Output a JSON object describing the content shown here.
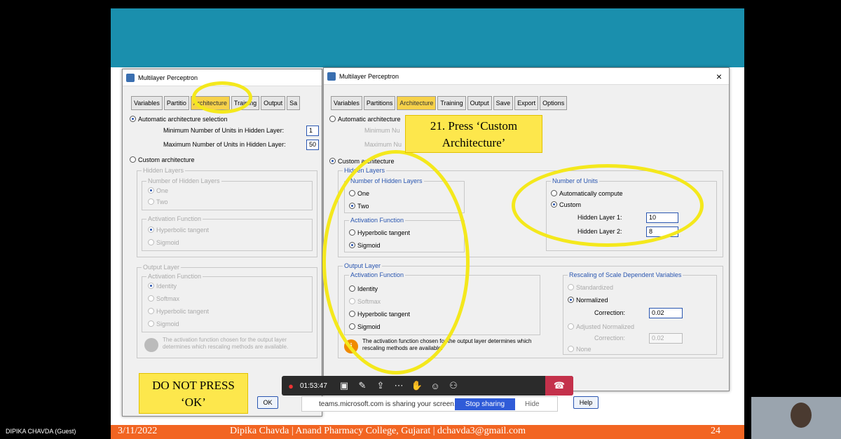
{
  "participant": "DIPIKA CHAVDA (Guest)",
  "slide": {
    "date": "3/11/2022",
    "footer_text": "Dipika Chavda | Anand Pharmacy College, Gujarat | dchavda3@gmail.com",
    "page": "24"
  },
  "back_dialog": {
    "title": "Multilayer Perceptron",
    "tabs": [
      "Variables",
      "Partitio",
      "Architecture",
      "Training",
      "Output",
      "Sa"
    ],
    "auto_label": "Automatic architecture selection",
    "min_label": "Minimum Number of Units in Hidden Layer:",
    "min_value": "1",
    "max_label": "Maximum Number of Units in Hidden Layer:",
    "max_value": "50",
    "custom_label": "Custom architecture",
    "hidden_layers": "Hidden Layers",
    "num_hidden": "Number of Hidden Layers",
    "one": "One",
    "two": "Two",
    "activation": "Activation Function",
    "hyperbolic": "Hyperbolic tangent",
    "sigmoid": "Sigmoid",
    "output_layer": "Output Layer",
    "out_activation": "Activation Function",
    "identity": "Identity",
    "softmax": "Softmax",
    "out_hyperbolic": "Hyperbolic tangent",
    "out_sigmoid": "Sigmoid",
    "info": "The activation function chosen for the output layer determines which rescaling methods are available.",
    "ok": "OK"
  },
  "dialog": {
    "title": "Multilayer Perceptron",
    "close": "×",
    "tabs": [
      "Variables",
      "Partitions",
      "Architecture",
      "Training",
      "Output",
      "Save",
      "Export",
      "Options"
    ],
    "auto_label": "Automatic architecture",
    "min_label": "Minimum Nu",
    "max_label": "Maximum Nu",
    "custom_label": "Custom architecture",
    "hidden_layers": "Hidden Layers",
    "num_hidden": "Number of Hidden Layers",
    "one": "One",
    "two": "Two",
    "activation": "Activation Function",
    "hyperbolic": "Hyperbolic tangent",
    "sigmoid": "Sigmoid",
    "num_units": "Number of Units",
    "auto_compute": "Automatically compute",
    "custom": "Custom",
    "h1_label": "Hidden Layer 1:",
    "h1_value": "10",
    "h2_label": "Hidden Layer 2:",
    "h2_value": "8",
    "output_layer": "Output Layer",
    "out_activation": "Activation Function",
    "identity": "Identity",
    "softmax": "Softmax",
    "out_hyperbolic": "Hyperbolic tangent",
    "out_sigmoid": "Sigmoid",
    "info": "The activation function chosen for the output layer determines which rescaling methods are available.",
    "rescaling": "Rescaling of Scale Dependent Variables",
    "standardized": "Standardized",
    "normalized": "Normalized",
    "correction_label": "Correction:",
    "correction_value": "0.02",
    "adj_normalized": "Adjusted Normalized",
    "adj_correction_label": "Correction:",
    "adj_correction_value": "0.02",
    "none": "None",
    "help": "Help"
  },
  "callouts": {
    "step": "21. Press ‘Custom Architecture’",
    "warning": "DO NOT PRESS ‘OK’"
  },
  "teams": {
    "time": "01:53:47",
    "sharing_text": "teams.microsoft.com is sharing your screen.",
    "stop_sharing": "Stop sharing",
    "hide": "Hide"
  }
}
